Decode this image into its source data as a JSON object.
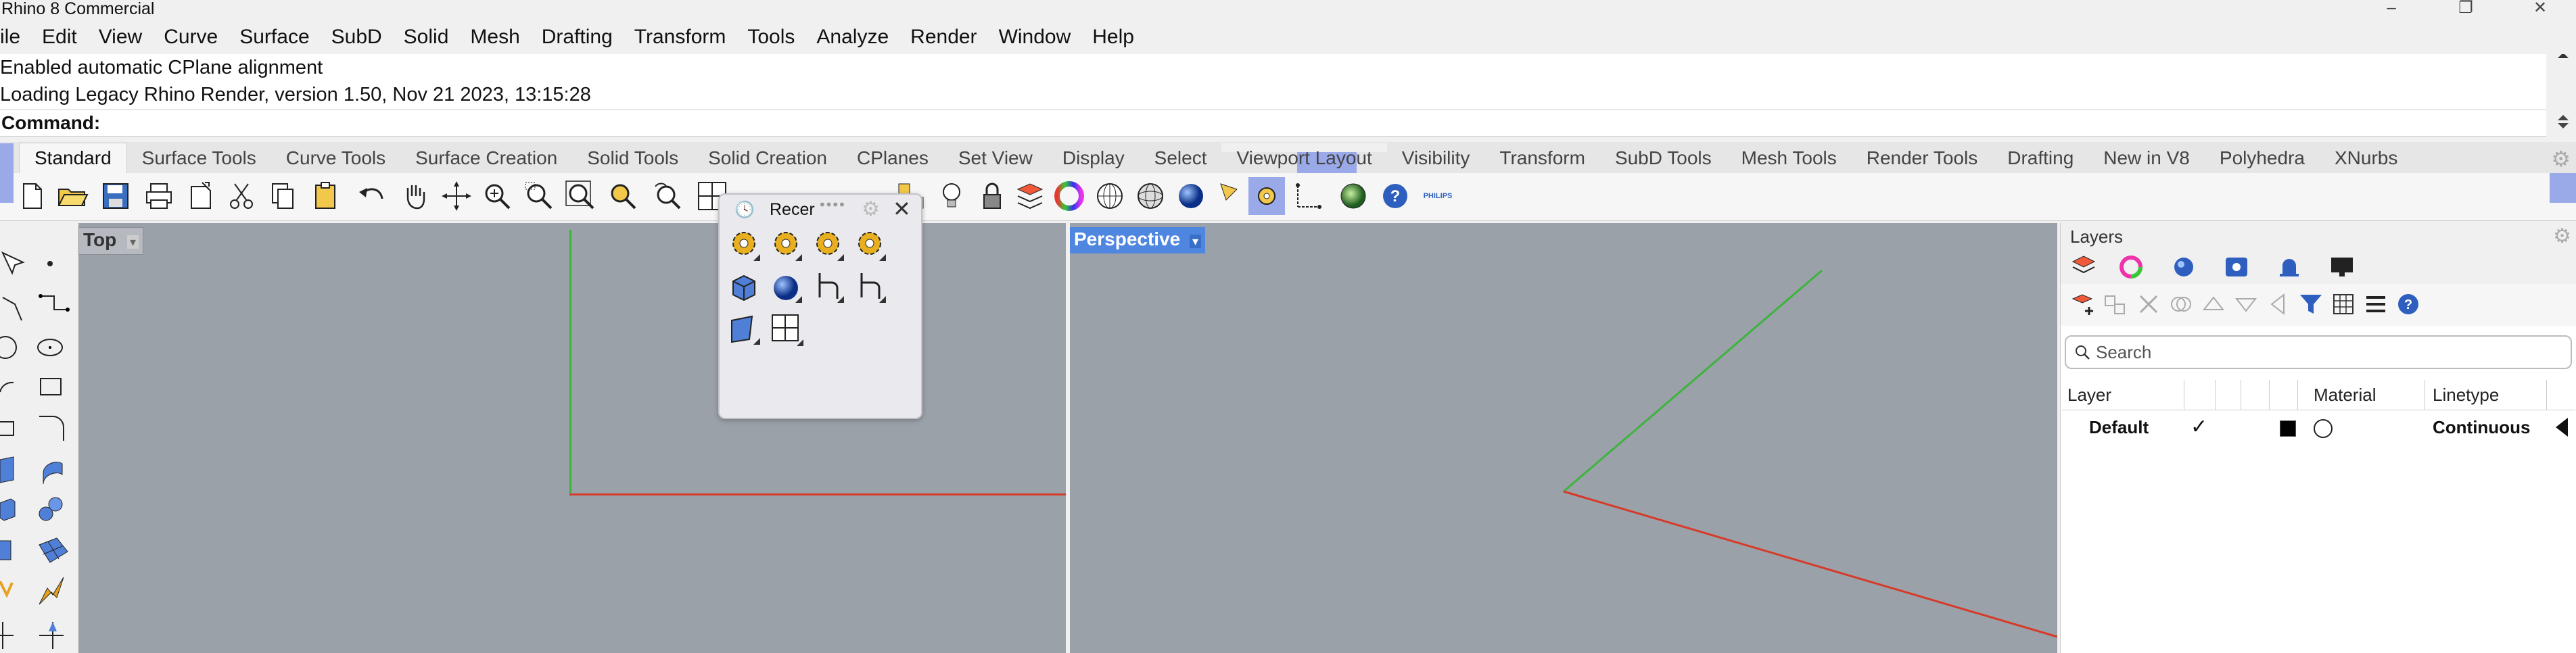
{
  "window": {
    "title": "Rhino 8 Commercial",
    "controls": [
      "–",
      "❐",
      "✕"
    ]
  },
  "menu": [
    "ile",
    "Edit",
    "View",
    "Curve",
    "Surface",
    "SubD",
    "Solid",
    "Mesh",
    "Drafting",
    "Transform",
    "Tools",
    "Analyze",
    "Render",
    "Window",
    "Help"
  ],
  "history": [
    "Enabled automatic CPlane alignment",
    "Loading Legacy Rhino Render, version 1.50, Nov 21 2023, 13:15:28"
  ],
  "command": {
    "label": "Command:"
  },
  "toolbar_tabs": [
    "Standard",
    "Surface Tools",
    "Curve Tools",
    "Surface Creation",
    "Solid Tools",
    "Solid Creation",
    "CPlanes",
    "Set View",
    "Display",
    "Select",
    "Viewport Layout",
    "Visibility",
    "Transform",
    "SubD Tools",
    "Mesh Tools",
    "Render Tools",
    "Drafting",
    "New in V8",
    "Polyhedra",
    "XNurbs"
  ],
  "philips_label": "PHILIPS",
  "viewports": {
    "top": {
      "label": "Top"
    },
    "perspective": {
      "label": "Perspective"
    }
  },
  "popup": {
    "title": "Recer"
  },
  "layers": {
    "title": "Layers",
    "search_placeholder": "Search",
    "columns": {
      "layer": "Layer",
      "material": "Material",
      "linetype": "Linetype"
    },
    "rows": [
      {
        "name": "Default",
        "current": "✓",
        "linetype": "Continuous"
      }
    ]
  },
  "colors": {
    "viewport_bg": "#9ba1a9",
    "x_axis": "#d63b2a",
    "y_axis": "#3cb43c",
    "active_label": "#4f86e0",
    "highlight": "#9aa9e8"
  }
}
